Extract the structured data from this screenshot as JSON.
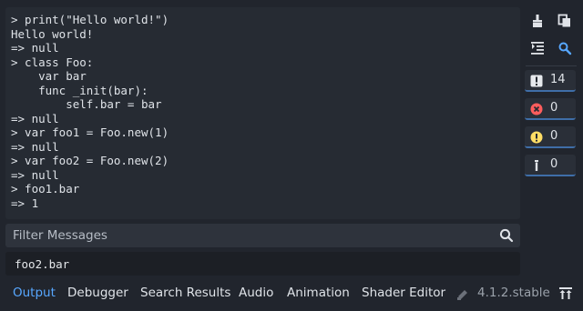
{
  "console": {
    "lines": [
      "> print(\"Hello world!\")",
      "Hello world!",
      "=> null",
      "> class Foo:",
      "    var bar",
      "    func _init(bar):",
      "        self.bar = bar",
      "=> null",
      "> var foo1 = Foo.new(1)",
      "=> null",
      "> var foo2 = Foo.new(2)",
      "=> null",
      "> foo1.bar",
      "=> 1"
    ]
  },
  "filter": {
    "placeholder": "Filter Messages"
  },
  "expression": {
    "value": "foo2.bar"
  },
  "side": {
    "counts": {
      "messages": "14",
      "errors": "0",
      "warnings": "0",
      "editor": "0"
    }
  },
  "tabs": {
    "items": [
      "Output",
      "Debugger",
      "Search Results",
      "Audio",
      "Animation",
      "Shader Editor"
    ],
    "active": "Output"
  },
  "version": "4.1.2.stable",
  "icons": {
    "clear": "broom-icon",
    "copy": "copy-icon",
    "collapse": "collapse-duplicates-icon",
    "search": "search-icon",
    "messages": "exclamation-icon",
    "errors": "error-icon",
    "warnings": "warning-icon",
    "editor": "editor-icon",
    "version": "godot-icon",
    "bottom_panel": "expand-panel-icon"
  },
  "colors": {
    "background": "#21252d",
    "console_bg": "#262b33",
    "accent": "#57a7ff",
    "error": "#ff5d5d",
    "warning": "#ffdd65",
    "text": "#dfe3e8"
  }
}
